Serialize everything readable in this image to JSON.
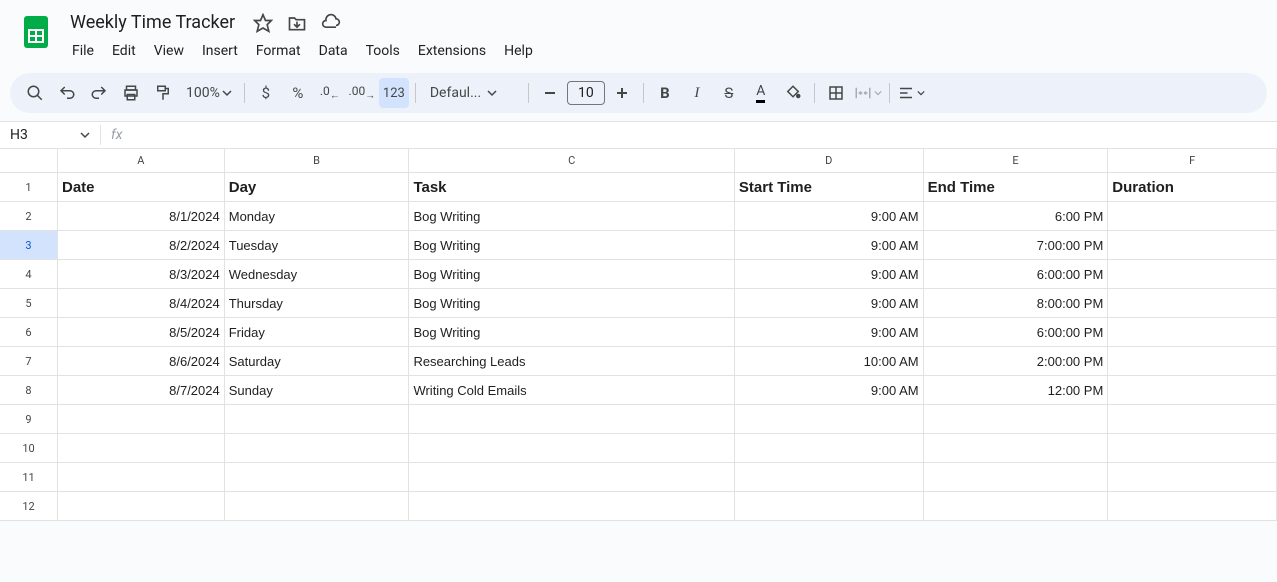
{
  "doc": {
    "title": "Weekly Time Tracker"
  },
  "menus": [
    "File",
    "Edit",
    "View",
    "Insert",
    "Format",
    "Data",
    "Tools",
    "Extensions",
    "Help"
  ],
  "toolbar": {
    "zoom": "100%",
    "font": "Defaul...",
    "font_size": "10",
    "number_format": "123"
  },
  "name_box": "H3",
  "formula": "",
  "columns": [
    "A",
    "B",
    "C",
    "D",
    "E",
    "F"
  ],
  "col_widths": [
    "cw-A",
    "cw-B",
    "cw-C",
    "cw-D",
    "cw-E",
    "cw-F"
  ],
  "row_count": 12,
  "selected_row": 3,
  "headers": {
    "A": "Date",
    "B": "Day",
    "C": "Task",
    "D": "Start Time",
    "E": "End Time",
    "F": "Duration"
  },
  "rows": [
    {
      "A": "8/1/2024",
      "B": "Monday",
      "C": "Bog Writing",
      "D": "9:00 AM",
      "E": "6:00 PM",
      "F": ""
    },
    {
      "A": "8/2/2024",
      "B": "Tuesday",
      "C": "Bog Writing",
      "D": "9:00 AM",
      "E": "7:00:00 PM",
      "F": ""
    },
    {
      "A": "8/3/2024",
      "B": "Wednesday",
      "C": "Bog Writing",
      "D": "9:00 AM",
      "E": "6:00:00 PM",
      "F": ""
    },
    {
      "A": "8/4/2024",
      "B": "Thursday",
      "C": "Bog Writing",
      "D": "9:00 AM",
      "E": "8:00:00 PM",
      "F": ""
    },
    {
      "A": "8/5/2024",
      "B": "Friday",
      "C": "Bog Writing",
      "D": "9:00 AM",
      "E": "6:00:00 PM",
      "F": ""
    },
    {
      "A": "8/6/2024",
      "B": "Saturday",
      "C": "Researching Leads",
      "D": "10:00 AM",
      "E": "2:00:00 PM",
      "F": ""
    },
    {
      "A": "8/7/2024",
      "B": "Sunday",
      "C": "Writing Cold Emails",
      "D": "9:00 AM",
      "E": "12:00 PM",
      "F": ""
    }
  ],
  "right_aligned_cols": [
    "A",
    "D",
    "E"
  ]
}
